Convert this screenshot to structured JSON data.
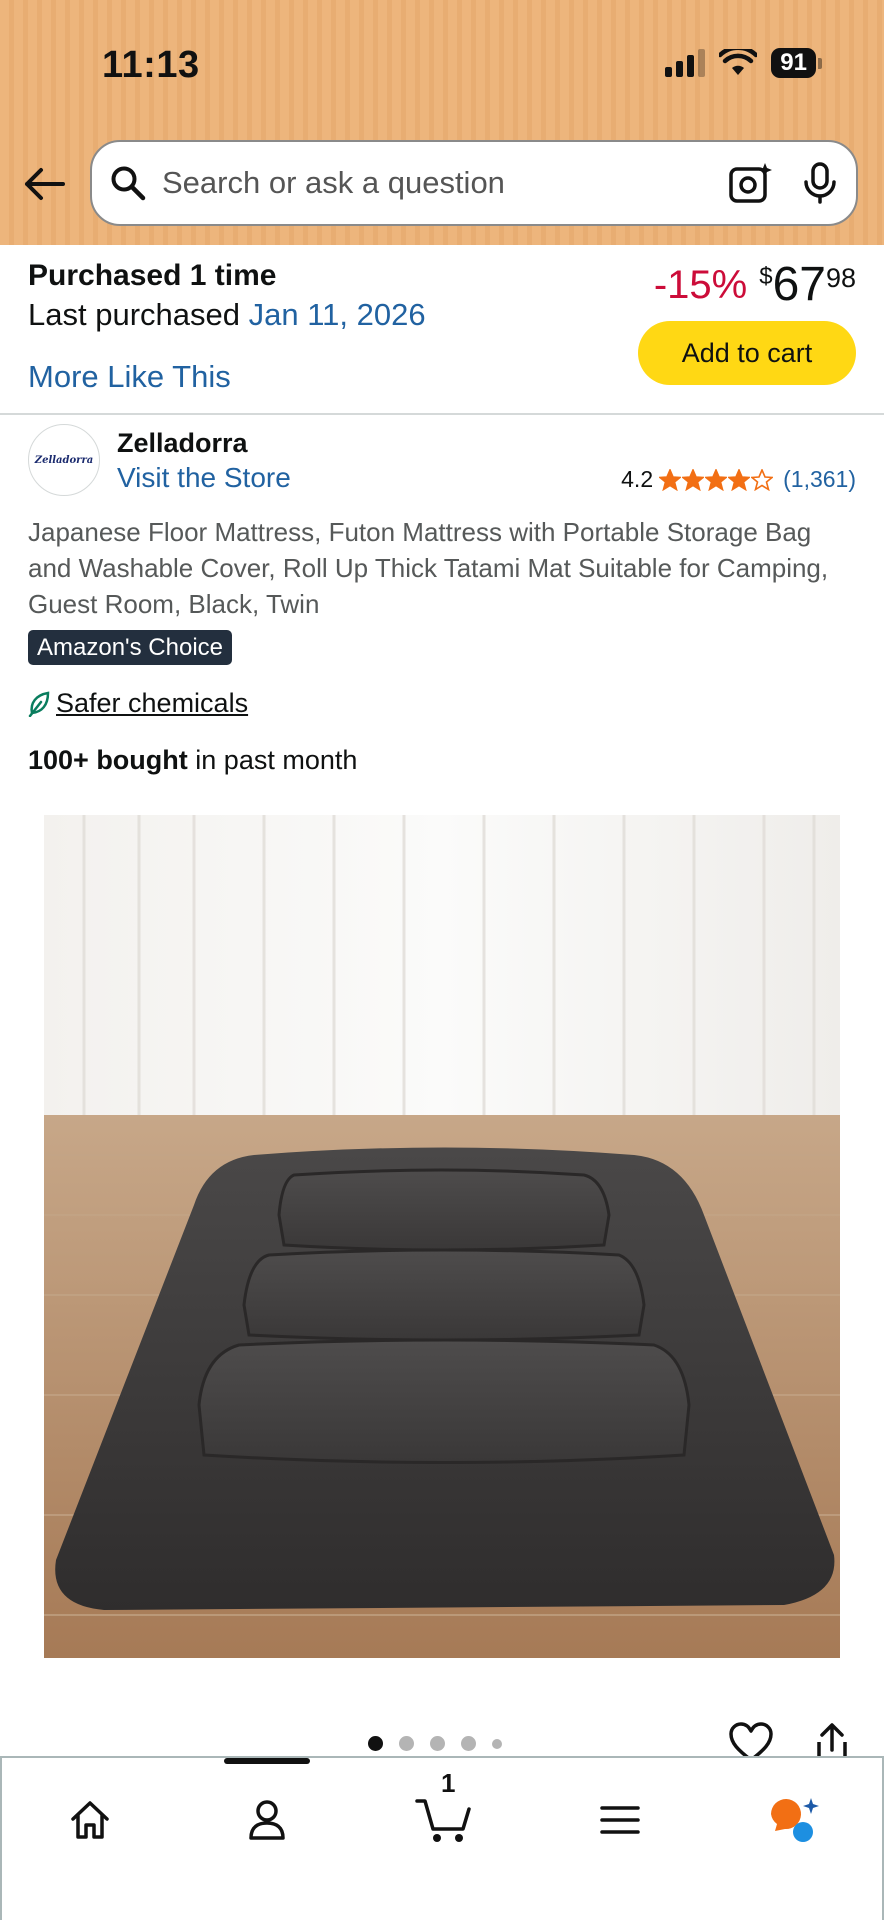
{
  "status_bar": {
    "time": "11:13",
    "battery": "91"
  },
  "search": {
    "placeholder": "Search or ask a question"
  },
  "purchase_info": {
    "times_label": "Purchased 1 time",
    "last_purchased_label": "Last purchased",
    "last_purchased_date": "Jan 11, 2026",
    "more_like_this": "More Like This"
  },
  "price": {
    "discount": "-15%",
    "currency": "$",
    "whole": "67",
    "fraction": "98"
  },
  "add_to_cart_label": "Add to cart",
  "store": {
    "logo_text": "Zelladorra",
    "name": "Zelladorra",
    "visit_label": "Visit the Store"
  },
  "rating": {
    "value": "4.2",
    "stars": 4.2,
    "count": "(1,361)"
  },
  "product": {
    "title": "Japanese Floor Mattress, Futon Mattress with Portable Storage Bag and Washable Cover, Roll Up Thick Tatami Mat Suitable for Camping, Guest Room, Black, Twin",
    "badge": "Amazon's Choice",
    "safer_chemicals": "Safer chemicals",
    "bought_bold": "100+ bought",
    "bought_rest": " in past month"
  },
  "carousel": {
    "total_dots": 5,
    "active_index": 0
  },
  "bottom_nav": {
    "items": [
      "home-icon",
      "account-icon",
      "cart-icon",
      "menu-icon",
      "rufus-icon"
    ],
    "cart_count": "1"
  },
  "colors": {
    "header_bg": "#edb57c",
    "link": "#2162a1",
    "discount": "#cc0c39",
    "add_to_cart": "#ffd814",
    "badge_bg": "#232f3e",
    "star": "#f26f14"
  }
}
